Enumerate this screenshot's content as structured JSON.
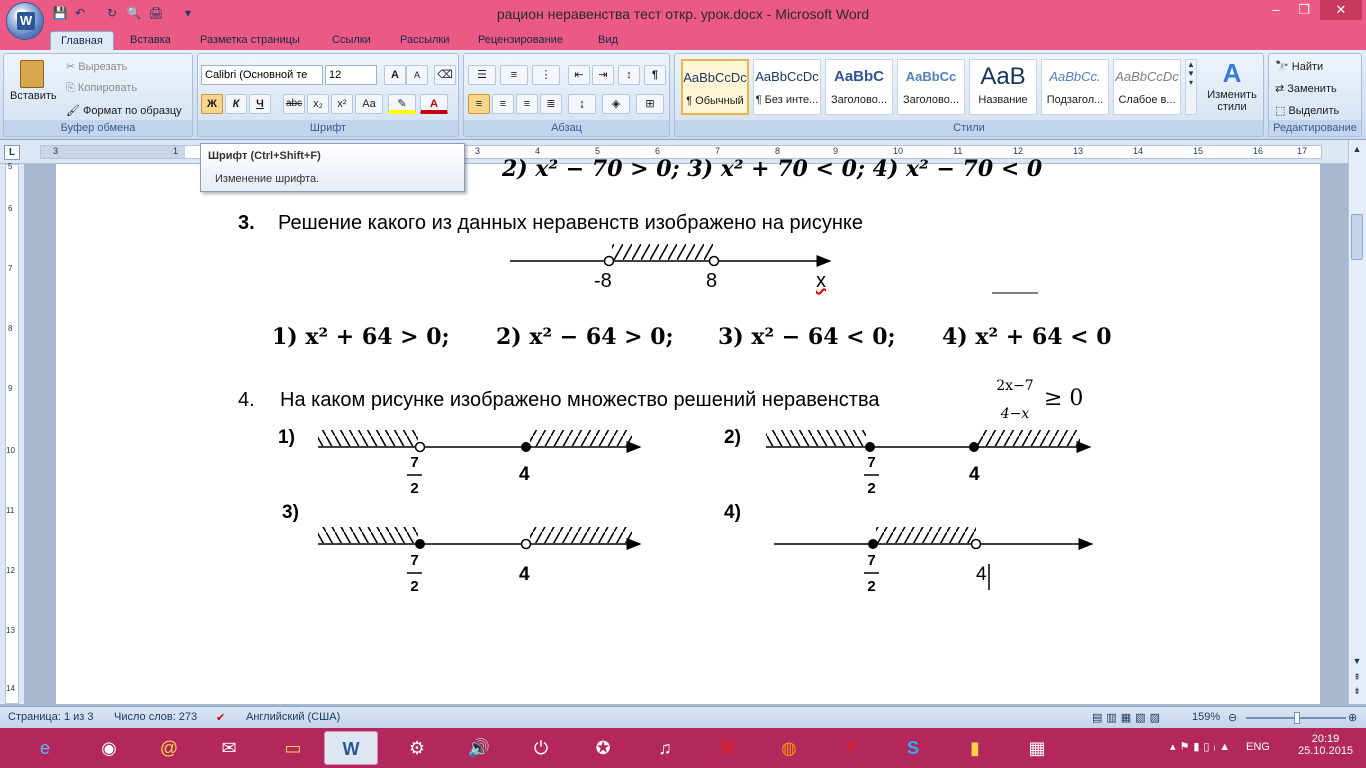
{
  "window": {
    "title": "рацион неравенства тест откр. урок.docx - Microsoft Word",
    "min": "–",
    "max": "❐",
    "close": "✕"
  },
  "qat": {
    "save": "💾",
    "undo": "↶",
    "redo": "↻",
    "preview": "🔍",
    "print": "🖨",
    "more": "▾"
  },
  "tabs": [
    "Главная",
    "Вставка",
    "Разметка страницы",
    "Ссылки",
    "Рассылки",
    "Рецензирование",
    "Вид"
  ],
  "clipboard": {
    "paste": "Вставить",
    "cut": "Вырезать",
    "copy": "Копировать",
    "format": "Формат по образцу",
    "label": "Буфер обмена"
  },
  "font": {
    "name": "Calibri (Основной те",
    "size": "12",
    "label": "Шрифт",
    "bold": "Ж",
    "italic": "К",
    "underline": "Ч",
    "strike": "abc",
    "sub": "x₂",
    "sup": "x²",
    "case": "Aa",
    "grow": "A",
    "shrink": "A"
  },
  "paragraph": {
    "label": "Абзац",
    "pilcrow": "¶"
  },
  "styles": {
    "label": "Стили",
    "items": [
      {
        "preview": "AaBbCcDc",
        "name": "¶ Обычный"
      },
      {
        "preview": "AaBbCcDc",
        "name": "¶ Без инте..."
      },
      {
        "preview": "AaBbC",
        "name": "Заголово..."
      },
      {
        "preview": "AaBbCc",
        "name": "Заголово..."
      },
      {
        "preview": "AaB",
        "name": "Название"
      },
      {
        "preview": "AaBbCc.",
        "name": "Подзагол..."
      },
      {
        "preview": "AaBbCcDc",
        "name": "Слабое в..."
      }
    ],
    "change": "Изменить стили"
  },
  "editing": {
    "find": "Найти",
    "replace": "Заменить",
    "select": "Выделить",
    "label": "Редактирование"
  },
  "tooltip": {
    "title": "Шрифт (Ctrl+Shift+F)",
    "desc": "Изменение шрифта."
  },
  "ruler": {
    "ticks": [
      "3",
      "1",
      "2",
      "1",
      "1",
      "2",
      "3",
      "4",
      "5",
      "6",
      "7",
      "8",
      "9",
      "10",
      "11",
      "12",
      "13",
      "14",
      "15",
      "16",
      "17"
    ],
    "vticks": [
      "5",
      "6",
      "7",
      "8",
      "9",
      "10",
      "11",
      "12",
      "13",
      "14"
    ]
  },
  "doc": {
    "top_row": "2) x² − 70 > 0;       3) x² + 70 < 0;       4) x² − 70 < 0",
    "q3_num": "3.",
    "q3_text": "Решение какого из данных неравенств изображено на рисунке",
    "q3_labels": {
      "a": "-8",
      "b": "8",
      "x": "x"
    },
    "q3_opts": [
      "1) x² + 64 > 0;",
      "2) x² − 64 > 0;",
      "3) x² − 64 < 0;",
      "4) x² + 64 < 0"
    ],
    "q4_num": "4.",
    "q4_text": "На каком рисунке изображено множество решений неравенства",
    "q4_frac_num": "2x−7",
    "q4_frac_den": "4−x",
    "q4_sign": "≥ 0",
    "variants": [
      {
        "label": "1)",
        "frac_num": "7",
        "frac_den": "2",
        "right": "4"
      },
      {
        "label": "2)",
        "frac_num": "7",
        "frac_den": "2",
        "right": "4"
      },
      {
        "label": "3)",
        "frac_num": "7",
        "frac_den": "2",
        "right": "4"
      },
      {
        "label": "4)",
        "frac_num": "7",
        "frac_den": "2",
        "right": "4"
      }
    ]
  },
  "status": {
    "page": "Страница: 1 из 3",
    "words": "Число слов: 273",
    "lang": "Английский (США)",
    "zoom": "159%"
  },
  "tray": {
    "lang": "ENG",
    "time": "20:19",
    "date": "25.10.2015"
  },
  "colors": {
    "titlebar": "#ea5a84",
    "taskbar": "#b3285c"
  }
}
